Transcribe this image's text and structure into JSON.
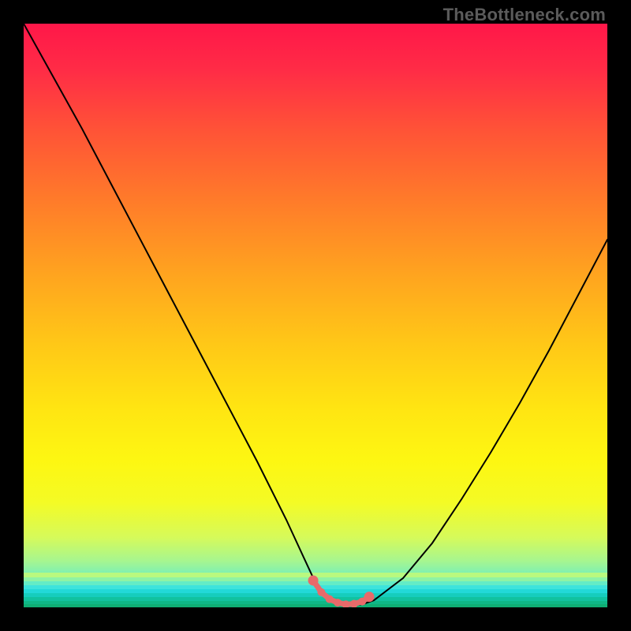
{
  "watermark": "TheBottleneck.com",
  "colors": {
    "curve_stroke": "#000000",
    "marker_stroke": "#e86a6a",
    "marker_fill": "#e86a6a"
  },
  "chart_data": {
    "type": "line",
    "title": "",
    "xlabel": "",
    "ylabel": "",
    "xlim": [
      0,
      100
    ],
    "ylim": [
      0,
      100
    ],
    "grid": false,
    "legend": false,
    "series": [
      {
        "name": "bottleneck-curve",
        "x": [
          0,
          5,
          10,
          15,
          20,
          25,
          30,
          35,
          40,
          45,
          48,
          50,
          52,
          54,
          56,
          58,
          60,
          65,
          70,
          75,
          80,
          85,
          90,
          95,
          100
        ],
        "y": [
          100,
          91,
          82,
          72.5,
          63,
          53.5,
          44,
          34.5,
          25,
          15,
          8.5,
          4.2,
          1.6,
          0.6,
          0.4,
          0.5,
          1.2,
          5,
          11,
          18.5,
          26.5,
          35,
          44,
          53.5,
          63
        ]
      }
    ],
    "markers": {
      "name": "highlight-dots",
      "x": [
        49.6,
        51.0,
        52.4,
        53.8,
        55.2,
        56.6,
        58.0,
        59.2
      ],
      "y": [
        4.6,
        2.6,
        1.4,
        0.8,
        0.5,
        0.6,
        1.0,
        1.8
      ]
    },
    "gradient_note": "Background encodes bottleneck severity: red (high) at top to green (low) at bottom."
  }
}
